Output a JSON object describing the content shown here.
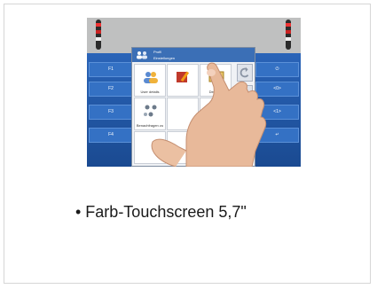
{
  "photo": {
    "left_keys": [
      "F1",
      "F2",
      "F3",
      "F4"
    ],
    "right_keys": [
      "⏻",
      "<0>",
      "<1>",
      "↵"
    ],
    "menu_header": {
      "line1": "Profil",
      "line2": "Einstellungen"
    },
    "cells": [
      {
        "label": "User details",
        "icon": "users-icon"
      },
      {
        "label": "",
        "icon": "pencil-icon"
      },
      {
        "label": "Desktop",
        "icon": "desktop-icon"
      },
      {
        "label": "Benachfragen zu",
        "icon": "network-icon"
      },
      {
        "label": "",
        "icon": "blank-icon"
      },
      {
        "label": "",
        "icon": "edit-icon"
      }
    ]
  },
  "caption": "• Farb-Touchscreen 5,7\""
}
